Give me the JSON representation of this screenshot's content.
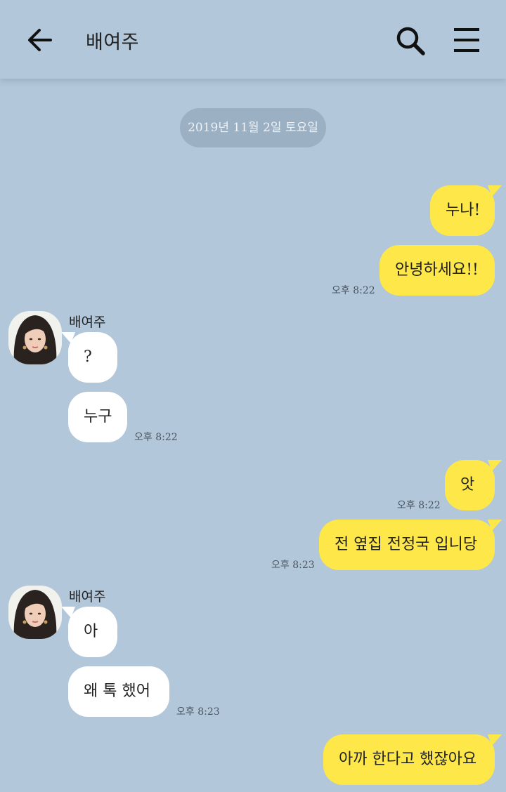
{
  "header": {
    "title": "배여주",
    "back_icon": "arrow-left-icon",
    "search_icon": "search-icon",
    "menu_icon": "hamburger-menu-icon"
  },
  "date_divider": "2019년 11월 2일 토요일",
  "messages": [
    {
      "from": "me",
      "text": "누나!"
    },
    {
      "from": "me",
      "text": "안녕하세요!!",
      "time": "오후 8:22"
    },
    {
      "from": "배여주",
      "sender_name": "배여주",
      "text": "?"
    },
    {
      "from": "배여주",
      "text": "누구",
      "time": "오후 8:22"
    },
    {
      "from": "me",
      "text": "앗",
      "time": "오후 8:22"
    },
    {
      "from": "me",
      "text": "전 옆집 전정국 입니당",
      "time": "오후 8:23"
    },
    {
      "from": "배여주",
      "sender_name": "배여주",
      "text": "아"
    },
    {
      "from": "배여주",
      "text": "왜 톡 했어",
      "time": "오후 8:23"
    },
    {
      "from": "me",
      "text": "아까 한다고 했잖아요"
    }
  ],
  "colors": {
    "background": "#b2c7d9",
    "my_bubble": "#fee849",
    "their_bubble": "#ffffff",
    "date_pill": "#9bb0c3"
  }
}
